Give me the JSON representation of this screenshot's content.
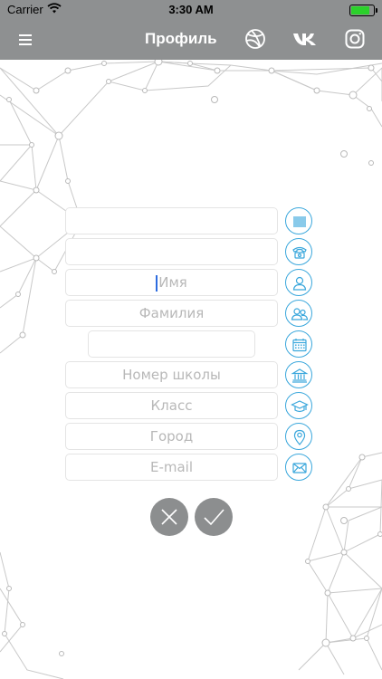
{
  "status": {
    "carrier": "Carrier",
    "time": "3:30 AM",
    "battery_level": 0.9
  },
  "nav": {
    "title": "Профиль",
    "icons": [
      "menu-icon",
      "dribbble-icon",
      "vk-icon",
      "instagram-icon"
    ]
  },
  "form": {
    "fields": [
      {
        "name": "barcode",
        "value": "",
        "placeholder": "",
        "icon": "barcode-icon"
      },
      {
        "name": "phone",
        "value": "",
        "placeholder": "",
        "icon": "phone-icon"
      },
      {
        "name": "first-name",
        "value": "",
        "placeholder": "Имя",
        "icon": "person-icon",
        "focused": true
      },
      {
        "name": "last-name",
        "value": "",
        "placeholder": "Фамилия",
        "icon": "people-icon"
      },
      {
        "name": "birthdate",
        "value": "",
        "placeholder": "",
        "icon": "calendar-icon"
      },
      {
        "name": "school-number",
        "value": "",
        "placeholder": "Номер школы",
        "icon": "school-icon"
      },
      {
        "name": "grade",
        "value": "",
        "placeholder": "Класс",
        "icon": "graduation-cap-icon"
      },
      {
        "name": "city",
        "value": "",
        "placeholder": "Город",
        "icon": "location-pin-icon"
      },
      {
        "name": "email",
        "value": "",
        "placeholder": "E-mail",
        "icon": "envelope-icon"
      }
    ]
  },
  "actions": {
    "cancel_icon": "close-icon",
    "confirm_icon": "checkmark-icon"
  },
  "colors": {
    "bar": "#8e9091",
    "accent": "#3aa7dc",
    "button": "#8c8e8f",
    "border": "#e4e4e4"
  }
}
